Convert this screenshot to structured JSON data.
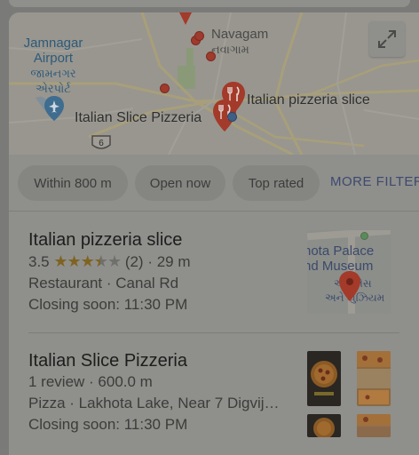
{
  "map": {
    "places": {
      "airport_en": "Jamnagar",
      "airport_en2": "Airport",
      "airport_gu": "જામનગર",
      "airport_gu2": "એરપોર્ટ",
      "navagam_en": "Navagam",
      "navagam_gu": "નવાગામ",
      "pizzeria_slice": "Italian pizzeria slice",
      "slice_pizzeria": "Italian Slice Pizzeria",
      "road_number": "6"
    },
    "expand_icon": "expand-icon"
  },
  "filters": {
    "chips": [
      "Within 800 m",
      "Open now",
      "Top rated"
    ],
    "more": "MORE FILTERS"
  },
  "results": [
    {
      "name": "Italian pizzeria slice",
      "rating": "3.5",
      "rating_value": 3.5,
      "reviews": "(2)",
      "distance": "· 29 m",
      "category_line": "Restaurant · Canal Rd",
      "hours": "Closing soon: 11:30 PM",
      "thumb_text_1": "hota Palace",
      "thumb_text_2": "nd Museum",
      "thumb_text_3": "અ પેલેસ",
      "thumb_text_4": "અને યુઝિયમ"
    },
    {
      "name": "Italian Slice Pizzeria",
      "review_line": "1 review · 600.0 m",
      "category_line": "Pizza · Lakhota Lake, Near 7 Digvij…",
      "hours": "Closing soon: 11:30 PM"
    }
  ],
  "colors": {
    "pin": "#a33a2a",
    "accent_link": "#3d4a70",
    "star": "#7f6420"
  }
}
